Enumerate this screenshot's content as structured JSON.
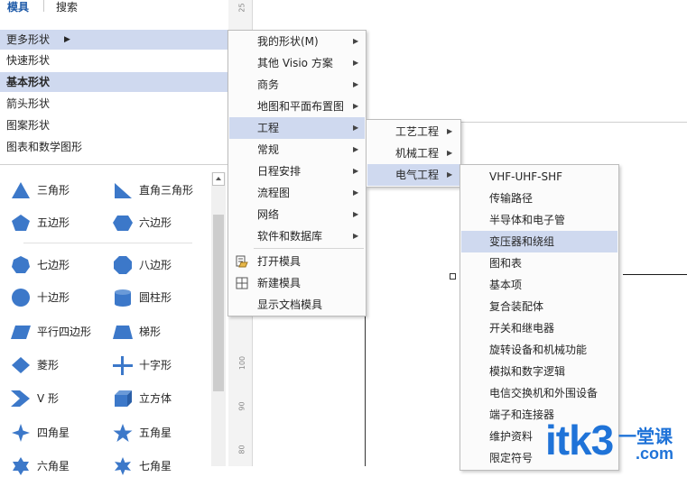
{
  "pane": {
    "tabs": [
      "模具",
      "搜索"
    ],
    "categories": [
      {
        "label": "更多形状",
        "arrow": "▶"
      },
      {
        "label": "快速形状"
      },
      {
        "label": "基本形状"
      },
      {
        "label": "箭头形状"
      },
      {
        "label": "图案形状"
      },
      {
        "label": "图表和数学图形"
      }
    ],
    "shapes": [
      {
        "label": "三角形",
        "icon": "triangle-icon"
      },
      {
        "label": "直角三角形",
        "icon": "right-triangle-icon"
      },
      {
        "label": "五边形",
        "icon": "pentagon-icon"
      },
      {
        "label": "六边形",
        "icon": "hexagon-icon"
      },
      {
        "label": "七边形",
        "icon": "heptagon-icon"
      },
      {
        "label": "八边形",
        "icon": "octagon-icon"
      },
      {
        "label": "十边形",
        "icon": "decagon-icon"
      },
      {
        "label": "圆柱形",
        "icon": "cylinder-icon"
      },
      {
        "label": "平行四边形",
        "icon": "parallelogram-icon"
      },
      {
        "label": "梯形",
        "icon": "trapezoid-icon"
      },
      {
        "label": "菱形",
        "icon": "diamond-icon"
      },
      {
        "label": "十字形",
        "icon": "cross-icon"
      },
      {
        "label": "V 形",
        "icon": "chevron-icon"
      },
      {
        "label": "立方体",
        "icon": "cube-icon"
      },
      {
        "label": "四角星",
        "icon": "four-point-star-icon"
      },
      {
        "label": "五角星",
        "icon": "five-point-star-icon"
      },
      {
        "label": "六角星",
        "icon": "six-point-star-icon"
      },
      {
        "label": "七角星",
        "icon": "seven-point-star-icon"
      }
    ]
  },
  "ruler": {
    "labels": [
      "25",
      "100",
      "90",
      "80"
    ]
  },
  "menu1": {
    "items": [
      {
        "label": "我的形状(M)",
        "arrow": "▶"
      },
      {
        "label": "其他 Visio 方案",
        "arrow": "▶"
      },
      {
        "label": "商务",
        "arrow": "▶"
      },
      {
        "label": "地图和平面布置图",
        "arrow": "▶"
      },
      {
        "label": "工程",
        "arrow": "▶"
      },
      {
        "label": "常规",
        "arrow": "▶"
      },
      {
        "label": "日程安排",
        "arrow": "▶"
      },
      {
        "label": "流程图",
        "arrow": "▶"
      },
      {
        "label": "网络",
        "arrow": "▶"
      },
      {
        "label": "软件和数据库",
        "arrow": "▶"
      },
      {
        "label": "打开模具",
        "icon": "open-stencil-icon"
      },
      {
        "label": "新建模具",
        "icon": "new-stencil-icon"
      },
      {
        "label": "显示文档模具"
      }
    ]
  },
  "menu2": {
    "items": [
      {
        "label": "工艺工程",
        "arrow": "▶"
      },
      {
        "label": "机械工程",
        "arrow": "▶"
      },
      {
        "label": "电气工程",
        "arrow": "▶"
      }
    ]
  },
  "menu3": {
    "items": [
      "VHF-UHF-SHF",
      "传输路径",
      "半导体和电子管",
      "变压器和绕组",
      "图和表",
      "基本项",
      "复合装配体",
      "开关和继电器",
      "旋转设备和机械功能",
      "模拟和数字逻辑",
      "电信交换机和外围设备",
      "端子和连接器",
      "维护资料",
      "限定符号"
    ]
  },
  "watermark": {
    "text": "itk3",
    "suffix": "一堂课",
    "domain": ".com"
  },
  "colors": {
    "highlight": "#cfd9ef",
    "shape_blue": "#3c78c9",
    "watermark_blue": "#1f73d8"
  }
}
